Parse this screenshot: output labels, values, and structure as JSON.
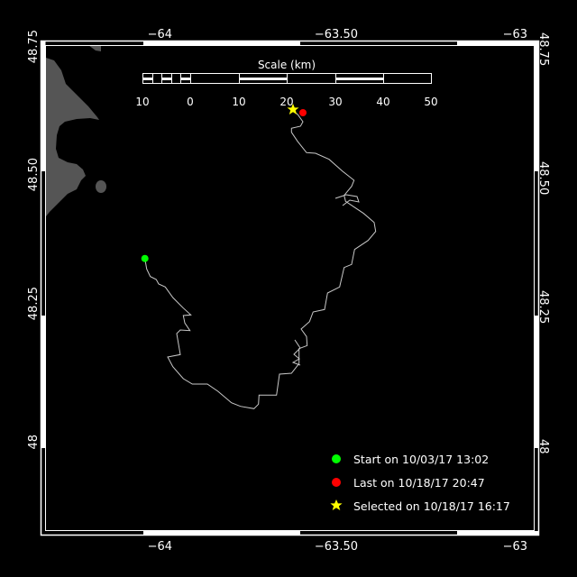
{
  "map": {
    "lon_ticks": [
      {
        "value": -64,
        "label": "−64"
      },
      {
        "value": -63.5,
        "label": "−63.50"
      },
      {
        "value": -63,
        "label": "−63"
      }
    ],
    "lat_ticks": [
      {
        "value": 48.75,
        "label": "48.75"
      },
      {
        "value": 48.5,
        "label": "48.50"
      },
      {
        "value": 48.25,
        "label": "48.25"
      },
      {
        "value": 48,
        "label": "48"
      }
    ],
    "land_color": "#555555",
    "track_color": "#c8c8c8"
  },
  "scale": {
    "title": "Scale (km)",
    "labels": [
      "10",
      "0",
      "10",
      "20",
      "30",
      "40",
      "50"
    ]
  },
  "legend": {
    "start": {
      "label": "Start on 10/03/17 13:02",
      "color": "#00ff00",
      "icon": "circle"
    },
    "last": {
      "label": "Last on 10/18/17 20:47",
      "color": "#ff0000",
      "icon": "circle"
    },
    "selected": {
      "label": "Selected on 10/18/17 16:17",
      "color": "#ffff00",
      "icon": "star"
    }
  }
}
